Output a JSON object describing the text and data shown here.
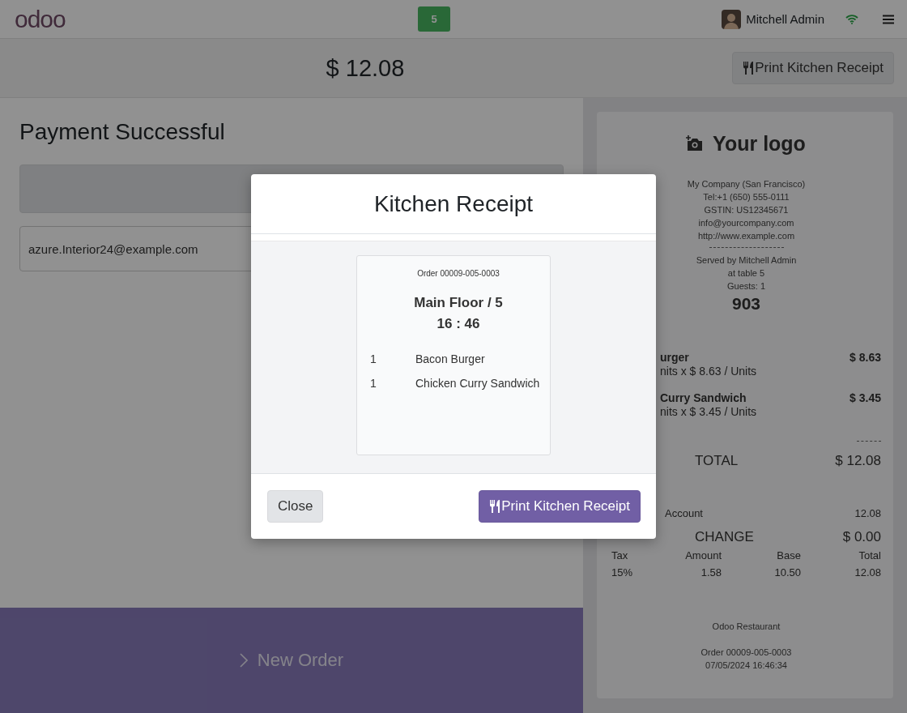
{
  "navbar": {
    "logo": "odoo",
    "table_badge": "5",
    "user": "Mitchell Admin"
  },
  "toolbar": {
    "amount": "$ 12.08",
    "print_button": "Print Kitchen Receipt"
  },
  "payment": {
    "title": "Payment Successful",
    "email_field": {
      "value": "azure.Interior24@example.com"
    },
    "new_order_button": "New Order"
  },
  "receipt": {
    "logo": "Your logo",
    "company_lines": [
      "My Company (San Francisco)",
      "Tel:+1 (650) 555-0111",
      "GSTIN: US12345671",
      "info@yourcompany.com",
      "http://www.example.com"
    ],
    "served_lines": [
      "Served by Mitchell Admin",
      "at table 5",
      "Guests: 1"
    ],
    "tracking_number": "903",
    "lines": [
      {
        "name": "urger",
        "detail": "nits x $ 8.63 / Units",
        "price": "$ 8.63"
      },
      {
        "name": "Curry Sandwich",
        "detail": "nits x $ 3.45 / Units",
        "price": "$ 3.45"
      }
    ],
    "total_label": "TOTAL",
    "total": "$ 12.08",
    "payment_label": "Account",
    "payment_amount": "12.08",
    "change_label": "CHANGE",
    "change": "$ 0.00",
    "tax_table": {
      "columns": [
        "Tax",
        "Amount",
        "Base",
        "Total"
      ],
      "rows": [
        [
          "15%",
          "1.58",
          "10.50",
          "12.08"
        ]
      ]
    },
    "footer": [
      "Odoo Restaurant",
      "Order 00009-005-0003",
      "07/05/2024 16:46:34"
    ]
  },
  "dialog": {
    "title": "Kitchen Receipt",
    "ticket": {
      "order": "Order 00009-005-0003",
      "table": "Main Floor / 5",
      "time": "16 : 46",
      "items": [
        {
          "qty": "1",
          "name": "Bacon Burger"
        },
        {
          "qty": "1",
          "name": "Chicken Curry Sandwich"
        }
      ]
    },
    "buttons": [
      {
        "kind": "secondary",
        "label": "Close"
      },
      {
        "kind": "primary",
        "label": "Print Kitchen Receipt"
      }
    ]
  }
}
